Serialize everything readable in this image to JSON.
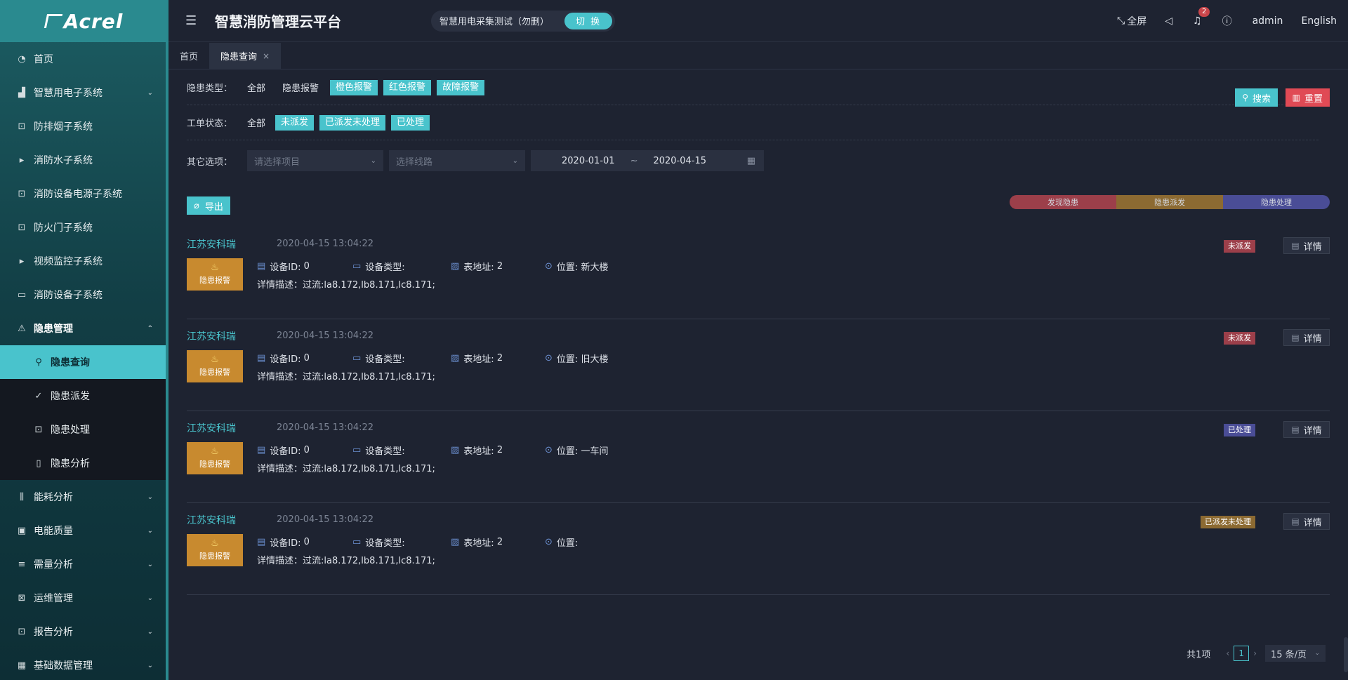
{
  "brand": {
    "logo_text": "Acrel"
  },
  "header": {
    "title": "智慧消防管理云平台",
    "project_name": "智慧用电采集测试（勿删）",
    "switch_label": "切 换",
    "fullscreen_label": "全屏",
    "notification_count": "2",
    "user": "admin",
    "language": "English"
  },
  "sidebar": {
    "items": [
      {
        "label": "首页",
        "icon": "dashboard-icon"
      },
      {
        "label": "智慧用电子系统",
        "icon": "chart-icon"
      },
      {
        "label": "防排烟子系统",
        "icon": "lock-icon"
      },
      {
        "label": "消防水子系统",
        "icon": "play-icon"
      },
      {
        "label": "消防设备电源子系统",
        "icon": "lock-icon"
      },
      {
        "label": "防火门子系统",
        "icon": "lock-icon"
      },
      {
        "label": "视频监控子系统",
        "icon": "play-icon"
      },
      {
        "label": "消防设备子系统",
        "icon": "video-icon"
      },
      {
        "label": "隐患管理",
        "icon": "warning-icon"
      }
    ],
    "submenu": [
      {
        "label": "隐患查询"
      },
      {
        "label": "隐患派发"
      },
      {
        "label": "隐患处理"
      },
      {
        "label": "隐患分析"
      }
    ],
    "bottom_items": [
      {
        "label": "能耗分析"
      },
      {
        "label": "电能质量"
      },
      {
        "label": "需量分析"
      },
      {
        "label": "运维管理"
      },
      {
        "label": "报告分析"
      },
      {
        "label": "基础数据管理"
      }
    ]
  },
  "tabs": [
    {
      "label": "首页"
    },
    {
      "label": "隐患查询"
    }
  ],
  "filters": {
    "type_label": "隐患类型：",
    "type_options": [
      "全部",
      "隐患报警"
    ],
    "type_tags": [
      "橙色报警",
      "红色报警",
      "故障报警"
    ],
    "status_label": "工单状态：",
    "status_options": [
      "全部"
    ],
    "status_tags": [
      "未派发",
      "已派发未处理",
      "已处理"
    ],
    "other_label": "其它选项：",
    "project_placeholder": "请选择项目",
    "line_placeholder": "选择线路",
    "date_start": "2020-01-01",
    "date_sep": "~",
    "date_end": "2020-04-15",
    "search_label": "搜索",
    "reset_label": "重置"
  },
  "toolbar": {
    "export_label": "导出",
    "legend": [
      "发现隐患",
      "隐患派发",
      "隐患处理"
    ]
  },
  "records": [
    {
      "company": "江苏安科瑞",
      "time": "2020-04-15 13:04:22",
      "type": "隐患报警",
      "device_id_label": "设备ID:",
      "device_id": "0",
      "device_type_label": "设备类型:",
      "meter_label": "表地址:",
      "meter": "2",
      "location_label": "位置:",
      "location": "新大楼",
      "desc": "详情描述：过流:la8.172,lb8.171,lc8.171;",
      "status": "未派发",
      "detail_label": "详情"
    },
    {
      "company": "江苏安科瑞",
      "time": "2020-04-15 13:04:22",
      "type": "隐患报警",
      "device_id_label": "设备ID:",
      "device_id": "0",
      "device_type_label": "设备类型:",
      "meter_label": "表地址:",
      "meter": "2",
      "location_label": "位置:",
      "location": "旧大楼",
      "desc": "详情描述：过流:la8.172,lb8.171,lc8.171;",
      "status": "未派发",
      "detail_label": "详情"
    },
    {
      "company": "江苏安科瑞",
      "time": "2020-04-15 13:04:22",
      "type": "隐患报警",
      "device_id_label": "设备ID:",
      "device_id": "0",
      "device_type_label": "设备类型:",
      "meter_label": "表地址:",
      "meter": "2",
      "location_label": "位置:",
      "location": "一车间",
      "desc": "详情描述：过流:la8.172,lb8.171,lc8.171;",
      "status": "已处理",
      "detail_label": "详情"
    },
    {
      "company": "江苏安科瑞",
      "time": "2020-04-15 13:04:22",
      "type": "隐患报警",
      "device_id_label": "设备ID:",
      "device_id": "0",
      "device_type_label": "设备类型:",
      "meter_label": "表地址:",
      "meter": "2",
      "location_label": "位置:",
      "location": "",
      "desc": "详情描述：过流:la8.172,lb8.171,lc8.171;",
      "status": "已派发未处理",
      "detail_label": "详情"
    }
  ],
  "pagination": {
    "total": "共1项",
    "current": "1",
    "page_size": "15 条/页"
  },
  "colors": {
    "accent": "#49c3cc",
    "danger": "#e04a55",
    "status_undispatched": "#9c3f4a",
    "status_pending": "#8c6a32",
    "status_done": "#4a4d96",
    "alarm": "#c88a2f"
  }
}
